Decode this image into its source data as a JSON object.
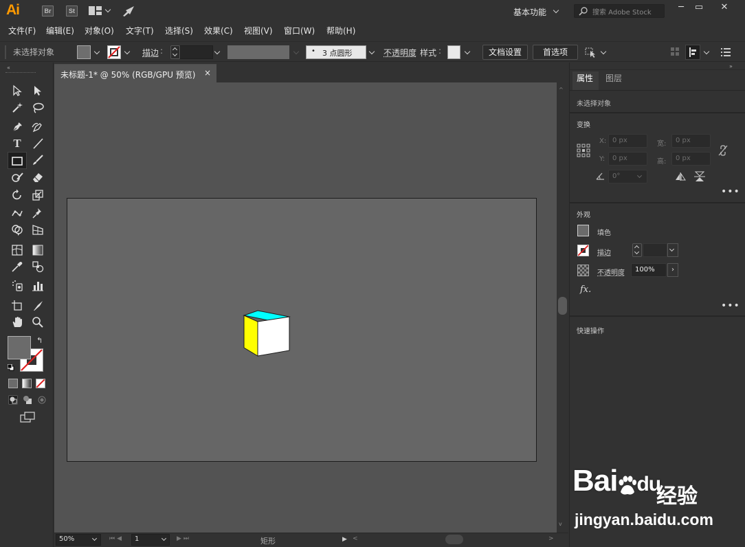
{
  "app": {
    "logo": "Ai",
    "badges": [
      "Br",
      "St"
    ],
    "workspace": "基本功能",
    "search_placeholder": "搜索 Adobe Stock"
  },
  "menu": [
    "文件(F)",
    "编辑(E)",
    "对象(O)",
    "文字(T)",
    "选择(S)",
    "效果(C)",
    "视图(V)",
    "窗口(W)",
    "帮助(H)"
  ],
  "control_bar": {
    "selection_status": "未选择对象",
    "stroke_label": "描边",
    "brush_label": "3 点圆形",
    "opacity_label": "不透明度",
    "style_label": "样式",
    "doc_setup": "文档设置",
    "preferences": "首选项"
  },
  "document": {
    "tab_title": "未标题-1* @ 50% (RGB/GPU 预览)",
    "close": "×"
  },
  "artwork": {
    "cube_colors": {
      "top": "#00ffff",
      "left": "#ffff00",
      "front": "#ffffff"
    }
  },
  "status_bar": {
    "zoom": "50%",
    "page": "1",
    "tool_status": "矩形"
  },
  "properties_panel": {
    "tabs": [
      "属性",
      "图层"
    ],
    "selection": "未选择对象",
    "transform_title": "变换",
    "x_label": "X:",
    "x_value": "0 px",
    "y_label": "Y:",
    "y_value": "0 px",
    "w_label": "宽:",
    "w_value": "0 px",
    "h_label": "高:",
    "h_value": "0 px",
    "angle_value": "0°",
    "appearance_title": "外观",
    "fill_label": "填色",
    "stroke_label": "描边",
    "opacity_label": "不透明度",
    "opacity_value": "100%",
    "fx_label": "fx.",
    "quick_actions_title": "快速操作",
    "more": "•••"
  },
  "watermark": {
    "brand": "Bai",
    "brand_end": "du",
    "product": "经验",
    "url": "jingyan.baidu.com"
  }
}
